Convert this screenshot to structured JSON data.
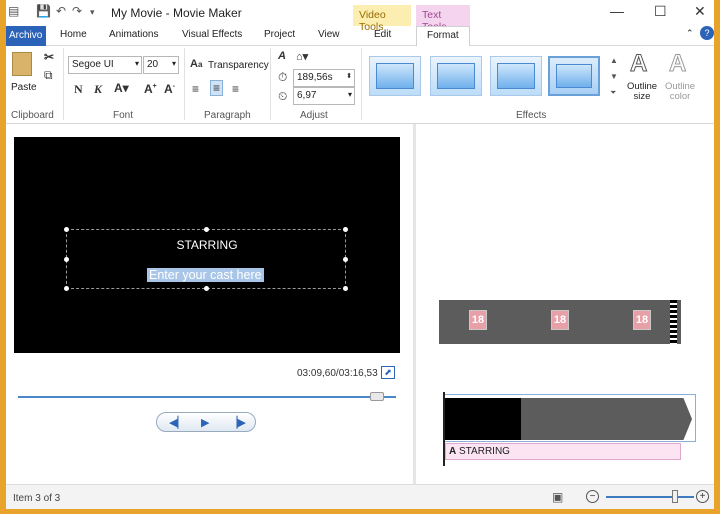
{
  "titlebar": {
    "title": "My Movie - Movie Maker",
    "context_video": "Video Tools",
    "context_text": "Text Tools"
  },
  "tabs": {
    "archivo": "Archivo",
    "home": "Home",
    "animations": "Animations",
    "visual_effects": "Visual Effects",
    "project": "Project",
    "view": "View",
    "edit": "Edit",
    "format": "Format"
  },
  "ribbon": {
    "paste_label": "Paste",
    "font_name": "Segoe UI",
    "font_size": "20",
    "transparency_label": "Transparency",
    "start_time": "189,56s",
    "duration": "6,97",
    "outline_size_label": "Outline size",
    "outline_color_label": "Outline color",
    "group_clipboard": "Clipboard",
    "group_font": "Font",
    "group_paragraph": "Paragraph",
    "group_adjust": "Adjust",
    "group_effects": "Effects"
  },
  "preview": {
    "title_text": "STARRING",
    "cast_text": "Enter your cast here",
    "time_readout": "03:09,60/03:16,53"
  },
  "storyboard": {
    "rating_label": "18",
    "caption_text": "STARRING"
  },
  "status": {
    "item_text": "Item 3 of 3"
  },
  "colors": {
    "accent": "#2b63b8",
    "frame": "#e8a32a",
    "video_tools": "#fbeeb0",
    "text_tools": "#f4d4ef"
  }
}
